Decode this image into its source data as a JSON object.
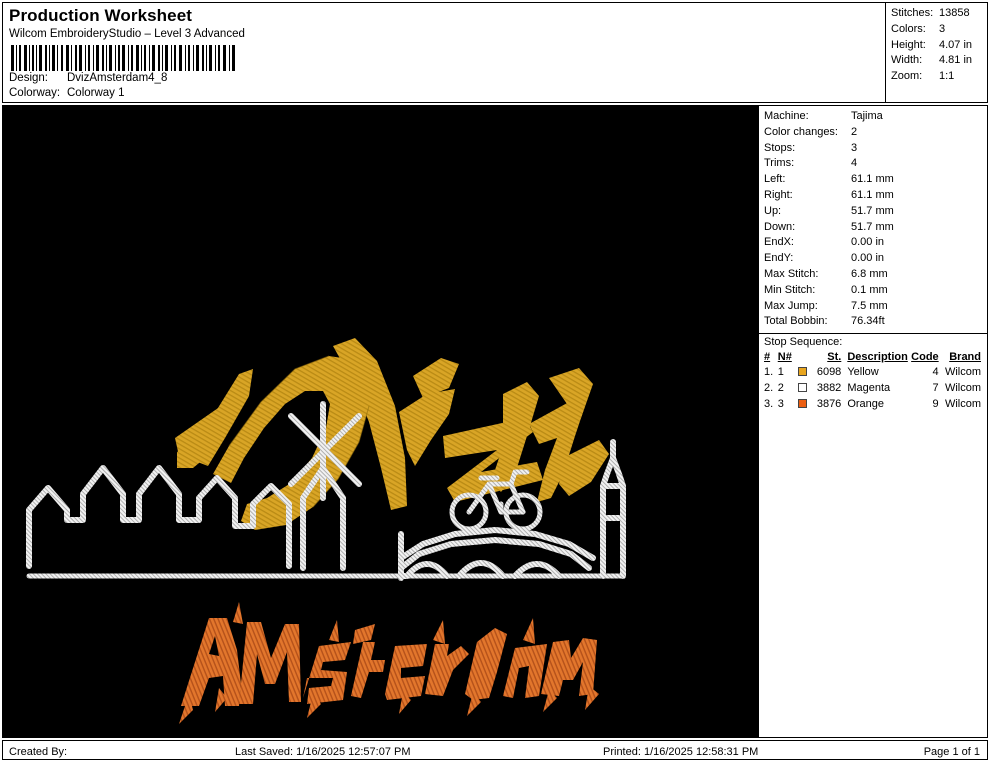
{
  "header": {
    "title": "Production Worksheet",
    "app_name": "Wilcom EmbroideryStudio – Level 3 Advanced",
    "barcode_icon": "barcode",
    "design_label": "Design:",
    "design_value": "DvizAmsterdam4_8",
    "colorway_label": "Colorway:",
    "colorway_value": "Colorway 1",
    "stats": [
      {
        "label": "Stitches:",
        "value": "13858"
      },
      {
        "label": "Colors:",
        "value": "3"
      },
      {
        "label": "Height:",
        "value": "4.07 in"
      },
      {
        "label": "Width:",
        "value": "4.81 in"
      },
      {
        "label": "Zoom:",
        "value": "1:1"
      }
    ]
  },
  "design": {
    "background_color": "#000000",
    "yellow": "#D9A526",
    "yellow_dark": "#A87C12",
    "orange": "#E2762C",
    "orange_dark": "#B4511A",
    "white": "#F2F2F2",
    "white_dark": "#B8B8B8",
    "wordmark_top": "Dvizh",
    "wordmark_bottom": "AMSTERDAM",
    "motifs": [
      "amsterdam-skyline",
      "windmill",
      "bicycle",
      "canal-bridge",
      "church-tower"
    ]
  },
  "info": {
    "rows": [
      {
        "label": "Machine:",
        "value": "Tajima"
      },
      {
        "label": "Color changes:",
        "value": "2"
      },
      {
        "label": "Stops:",
        "value": "3"
      },
      {
        "label": "Trims:",
        "value": "4"
      },
      {
        "label": "Left:",
        "value": "61.1 mm"
      },
      {
        "label": "Right:",
        "value": "61.1 mm"
      },
      {
        "label": "Up:",
        "value": "51.7 mm"
      },
      {
        "label": "Down:",
        "value": "51.7 mm"
      },
      {
        "label": "EndX:",
        "value": "0.00 in"
      },
      {
        "label": "EndY:",
        "value": "0.00 in"
      },
      {
        "label": "Max Stitch:",
        "value": "6.8 mm"
      },
      {
        "label": "Min Stitch:",
        "value": "0.1 mm"
      },
      {
        "label": "Max Jump:",
        "value": "7.5 mm"
      },
      {
        "label": "Total Bobbin:",
        "value": "76.34ft"
      }
    ]
  },
  "stop_sequence": {
    "title": "Stop Sequence:",
    "columns": [
      "#",
      "N#",
      "St.",
      "Description",
      "Code",
      "Brand"
    ],
    "rows": [
      {
        "num": "1.",
        "nnum": "1",
        "swatch": "#E8A51E",
        "st": "6098",
        "description": "Yellow",
        "code": "4",
        "brand": "Wilcom"
      },
      {
        "num": "2.",
        "nnum": "2",
        "swatch": "#FFFFFF",
        "st": "3882",
        "description": "Magenta",
        "code": "7",
        "brand": "Wilcom"
      },
      {
        "num": "3.",
        "nnum": "3",
        "swatch": "#EC5E11",
        "st": "3876",
        "description": "Orange",
        "code": "9",
        "brand": "Wilcom"
      }
    ]
  },
  "footer": {
    "created_by": "Created By:",
    "last_saved": "Last Saved: 1/16/2025 12:57:07 PM",
    "printed": "Printed: 1/16/2025 12:58:31 PM",
    "page": "Page 1 of 1"
  }
}
